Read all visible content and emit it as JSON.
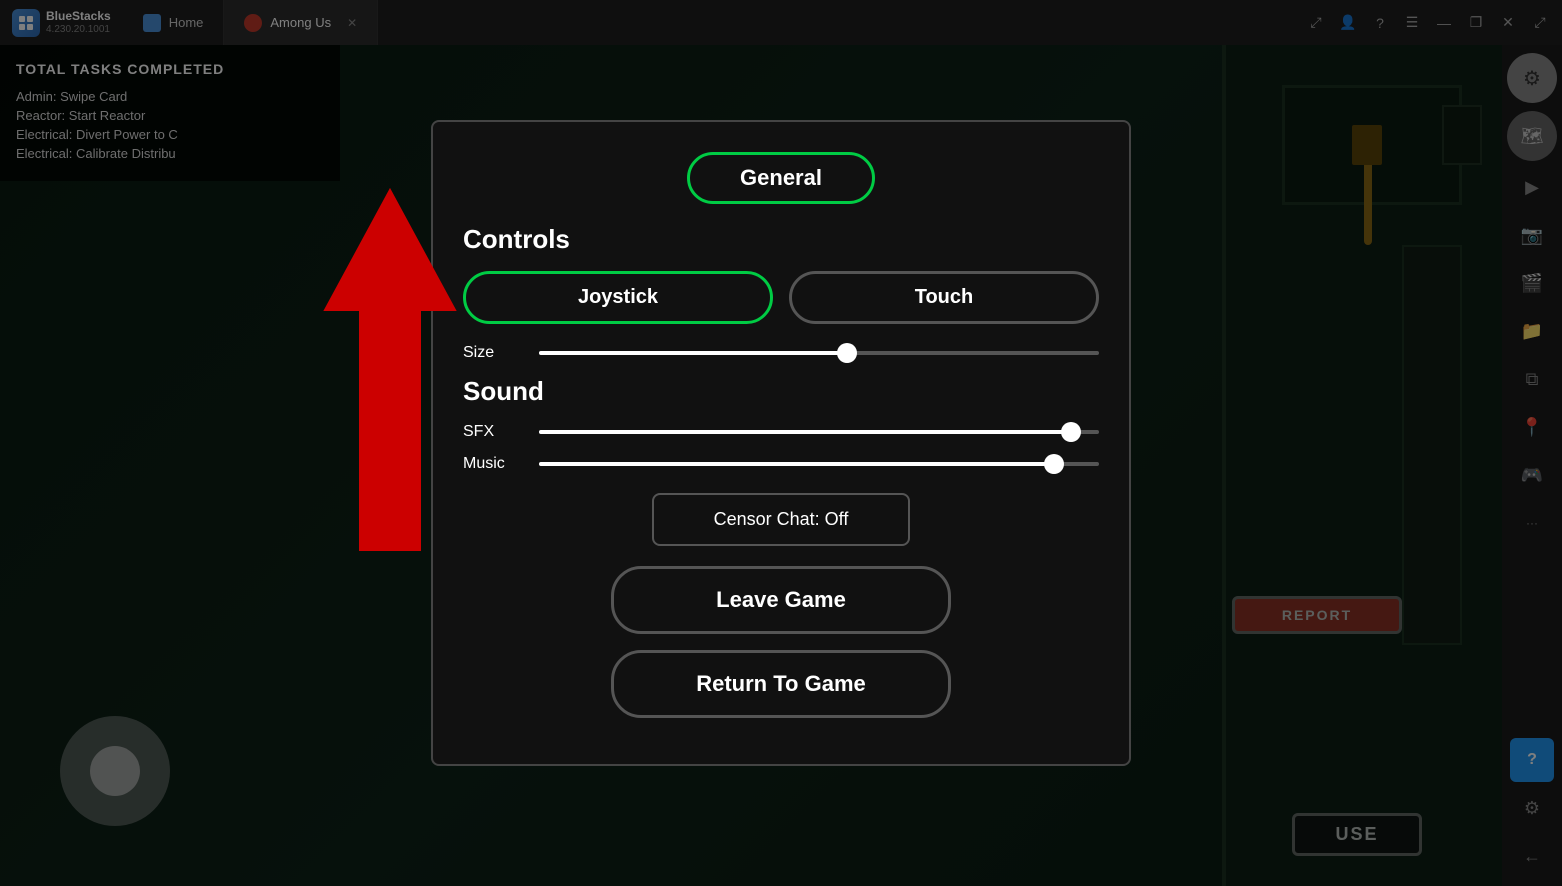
{
  "titlebar": {
    "app_name": "BlueStacks",
    "app_version": "4.230.20.1001",
    "tabs": [
      {
        "id": "home",
        "label": "Home",
        "active": false
      },
      {
        "id": "among-us",
        "label": "Among Us",
        "active": true
      }
    ],
    "controls": {
      "minimize": "—",
      "restore": "❐",
      "close": "✕",
      "expand": "⤢"
    }
  },
  "task_list": {
    "title": "TOTAL TASKS COMPLETED",
    "tasks": [
      "Admin: Swipe Card",
      "Reactor: Start Reactor",
      "Electrical: Divert Power to C",
      "Electrical: Calibrate Distribu"
    ]
  },
  "settings_modal": {
    "tab_general": "General",
    "controls_heading": "Controls",
    "btn_joystick": "Joystick",
    "btn_touch": "Touch",
    "size_label": "Size",
    "sound_heading": "Sound",
    "sfx_label": "SFX",
    "music_label": "Music",
    "censor_chat": "Censor Chat: Off",
    "leave_game": "Leave Game",
    "return_to_game": "Return To Game",
    "size_pct": 55,
    "sfx_pct": 95,
    "music_pct": 92
  },
  "sidebar": {
    "buttons": [
      {
        "name": "settings-gear",
        "icon": "⚙",
        "style": "gear"
      },
      {
        "name": "map",
        "icon": "🗺",
        "style": "map"
      },
      {
        "name": "cast",
        "icon": "▶",
        "style": "normal"
      },
      {
        "name": "screenshot",
        "icon": "📷",
        "style": "normal"
      },
      {
        "name": "video",
        "icon": "🎬",
        "style": "normal"
      },
      {
        "name": "folder",
        "icon": "📁",
        "style": "normal"
      },
      {
        "name": "layers",
        "icon": "⧉",
        "style": "normal"
      },
      {
        "name": "location",
        "icon": "📍",
        "style": "normal"
      },
      {
        "name": "gamepad",
        "icon": "🎮",
        "style": "normal"
      },
      {
        "name": "more",
        "icon": "···",
        "style": "normal"
      },
      {
        "name": "help",
        "icon": "?",
        "style": "question"
      },
      {
        "name": "settings-small",
        "icon": "⚙",
        "style": "normal"
      },
      {
        "name": "back",
        "icon": "←",
        "style": "normal"
      }
    ]
  }
}
